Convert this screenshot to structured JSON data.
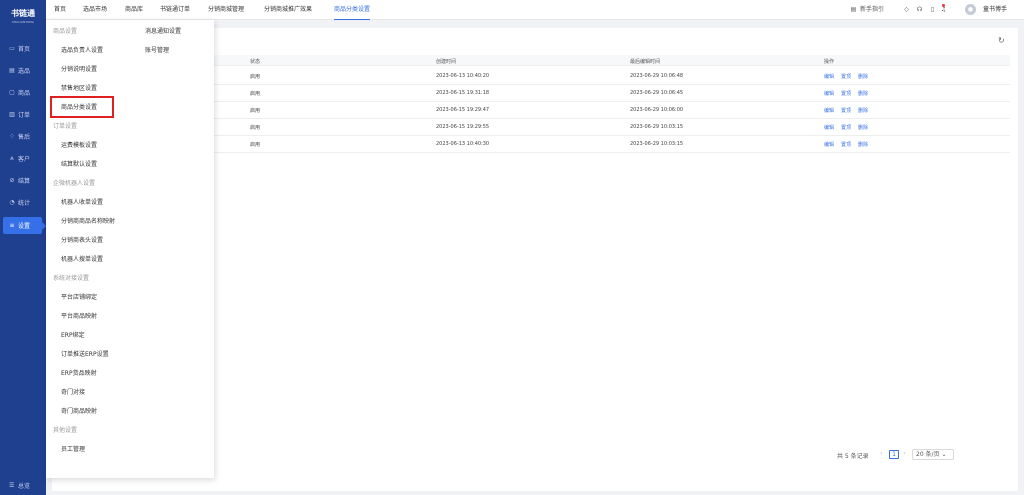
{
  "sidebar": {
    "logo": "书链通",
    "logo_sub": "SHULIANTONG",
    "items": [
      {
        "icon": "▭",
        "label": "首页"
      },
      {
        "icon": "▤",
        "label": "选品"
      },
      {
        "icon": "▢",
        "label": "商品"
      },
      {
        "icon": "▥",
        "label": "订单"
      },
      {
        "icon": "♢",
        "label": "售后"
      },
      {
        "icon": "ጰ",
        "label": "客户"
      },
      {
        "icon": "⊘",
        "label": "结算"
      },
      {
        "icon": "◔",
        "label": "统计"
      },
      {
        "icon": "≡",
        "label": "设置"
      }
    ],
    "bottom": {
      "icon": "☰",
      "label": "总览"
    }
  },
  "topbar": {
    "tabs": [
      "首页",
      "选品市场",
      "商品库",
      "书链通订单",
      "分销商城管理",
      "分销商城推广效果",
      "商品分类设置"
    ],
    "active_tab": "商品分类设置",
    "guide": "新手指引",
    "username": "童书博手"
  },
  "dropdown": {
    "groups": [
      {
        "title": "商品设置",
        "items": [
          "选品负责人设置",
          "分销说明设置",
          "禁售地区设置",
          "商品分类设置"
        ]
      },
      {
        "title": "订单设置",
        "items": [
          "运费模板设置",
          "结算默认设置"
        ]
      },
      {
        "title": "企微机器人设置",
        "items": [
          "机器人收单设置",
          "分销商商品名称映射",
          "分销商表头设置",
          "机器人搜单设置"
        ]
      },
      {
        "title": "系统对接设置",
        "items": [
          "平台店铺绑定",
          "平台商品映射",
          "ERP绑定",
          "订单推送ERP设置",
          "ERP货品映射",
          "奇门对接",
          "奇门商品映射"
        ]
      },
      {
        "title": "其他设置",
        "items": [
          "员工管理"
        ]
      }
    ],
    "col2": [
      "消息通知设置",
      "账号管理"
    ],
    "highlighted": "商品分类设置"
  },
  "table": {
    "headers": [
      "状态",
      "创建时间",
      "最后编辑时间",
      "操作"
    ],
    "rows": [
      {
        "status": "启用",
        "created": "2023-06-13 10:40:20",
        "edited": "2023-06-29 10:06:48"
      },
      {
        "status": "启用",
        "created": "2023-06-15 19:31:18",
        "edited": "2023-06-29 10:06:45"
      },
      {
        "status": "启用",
        "created": "2023-06-15 19:29:47",
        "edited": "2023-06-29 10:06:00"
      },
      {
        "status": "启用",
        "created": "2023-06-15 19:29:55",
        "edited": "2023-06-29 10:03:15"
      },
      {
        "status": "启用",
        "created": "2023-06-13 10:40:30",
        "edited": "2023-06-29 10:03:15"
      }
    ],
    "actions": [
      "编辑",
      "置顶",
      "删除"
    ]
  },
  "pagination": {
    "total": "共 5 条记录",
    "page": "1",
    "size": "20 条/页"
  },
  "colors": {
    "sidebar": "#1f3f8f",
    "accent": "#3670e8",
    "highlight": "#e02020"
  }
}
